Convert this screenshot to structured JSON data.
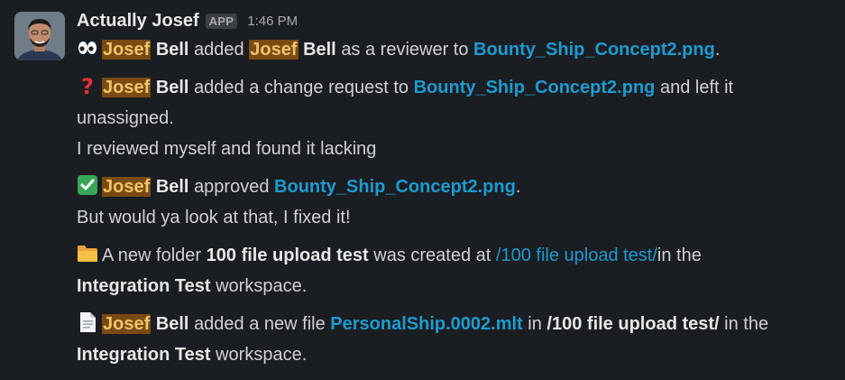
{
  "sender": {
    "name": "Actually Josef",
    "badge": "APP",
    "time": "1:46 PM"
  },
  "messages": [
    {
      "emoji": "eyes-icon",
      "actor_first": "Josef",
      "actor_last": "Bell",
      "text1": "added",
      "target_first": "Josef",
      "target_last": "Bell",
      "text2": "as a reviewer to",
      "file": "Bounty_Ship_Concept2.png",
      "end": "."
    },
    {
      "emoji": "question-icon",
      "actor_first": "Josef",
      "actor_last": "Bell",
      "text1": "added a change request to",
      "file": "Bounty_Ship_Concept2.png",
      "text2": "and left it",
      "text3": "unassigned.",
      "note": "I reviewed myself and found it lacking"
    },
    {
      "emoji": "check-icon",
      "actor_first": "Josef",
      "actor_last": "Bell",
      "text1": "approved",
      "file": "Bounty_Ship_Concept2.png",
      "end": ".",
      "note": "But would ya look at that, I fixed it!"
    },
    {
      "emoji": "folder-icon",
      "text1": "A new folder",
      "folder": "100 file upload test",
      "text2": "was created at",
      "path": "/100 file upload test/",
      "text3": "in the",
      "workspace": "Integration Test",
      "text4": "workspace."
    },
    {
      "emoji": "page-icon",
      "actor_first": "Josef",
      "actor_last": "Bell",
      "text1": "added a new file",
      "file": "PersonalShip.0002.mlt",
      "text2": "in",
      "path": "/100 file upload test/",
      "text3": "in the",
      "workspace": "Integration Test",
      "text4": "workspace."
    }
  ]
}
